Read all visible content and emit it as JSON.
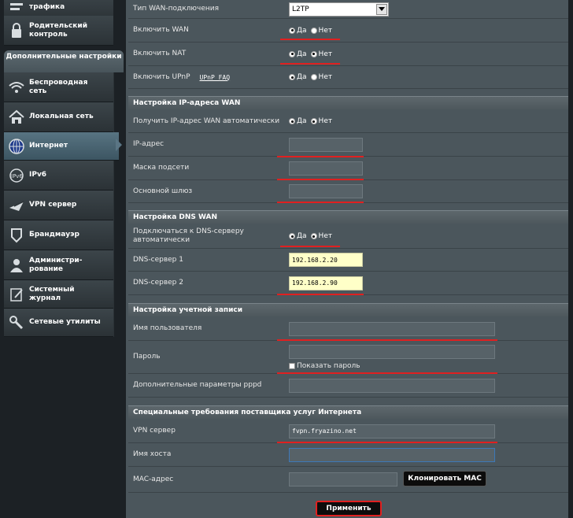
{
  "sidebar": {
    "top_items": [
      {
        "label": "трафика",
        "icon": "traffic-icon"
      },
      {
        "label": "Родительский\nконтроль",
        "icon": "parental-lock-icon"
      }
    ],
    "advanced_header": "Дополнительные\nнастройки",
    "items": [
      {
        "label": "Беспроводная\nсеть",
        "icon": "wifi-icon"
      },
      {
        "label": "Локальная сеть",
        "icon": "home-icon"
      },
      {
        "label": "Интернет",
        "icon": "globe-icon",
        "active": true
      },
      {
        "label": "IPv6",
        "icon": "ipv6-icon"
      },
      {
        "label": "VPN сервер",
        "icon": "vpn-icon"
      },
      {
        "label": "Брандмауэр",
        "icon": "shield-icon"
      },
      {
        "label": "Администри-\nрование",
        "icon": "admin-user-icon"
      },
      {
        "label": "Системный\nжурнал",
        "icon": "log-icon"
      },
      {
        "label": "Сетевые утилиты",
        "icon": "tools-icon"
      }
    ]
  },
  "basic": {
    "wan_type_label": "Тип WAN-подключения",
    "wan_type_value": "L2TP",
    "enable_wan_label": "Включить WAN",
    "enable_nat_label": "Включить NAT",
    "enable_upnp_label": "Включить UPnP",
    "upnp_faq": "UPnP FAQ",
    "yes": "Да",
    "no": "Нет"
  },
  "wan_ip": {
    "title": "Настройка IP-адреса WAN",
    "auto_label": "Получить IP-адрес WAN автоматически",
    "ip_label": "IP-адрес",
    "mask_label": "Маска подсети",
    "gateway_label": "Основной шлюз"
  },
  "dns": {
    "title": "Настройка DNS WAN",
    "auto_label": "Подключаться к DNS-серверу\nавтоматически",
    "dns1_label": "DNS-сервер 1",
    "dns1_value": "192.168.2.20",
    "dns2_label": "DNS-сервер 2",
    "dns2_value": "192.168.2.90"
  },
  "account": {
    "title": "Настройка учетной записи",
    "username_label": "Имя пользователя",
    "password_label": "Пароль",
    "show_password_label": "Показать пароль",
    "pppd_label": "Дополнительные параметры pppd"
  },
  "isp": {
    "title": "Специальные требования поставщика услуг Интернета",
    "vpn_label": "VPN сервер",
    "vpn_value": "fvpn.fryazino.net",
    "hostname_label": "Имя хоста",
    "mac_label": "MAC-адрес",
    "clone_mac": "Клонировать MAC"
  },
  "apply_label": "Применить",
  "colors": {
    "accent_red": "#e02020",
    "active_tab": "#587482"
  }
}
